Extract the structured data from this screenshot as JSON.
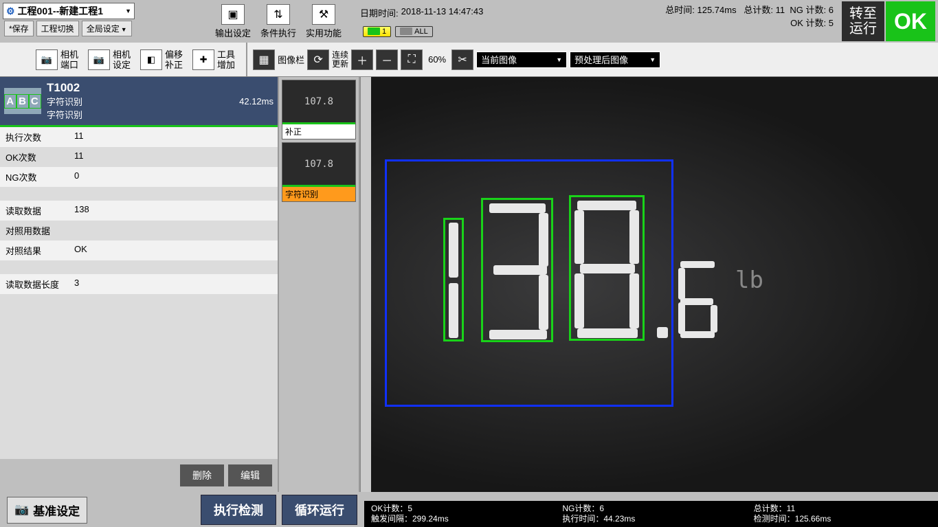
{
  "project": {
    "name": "工程001--新建工程1"
  },
  "topButtons": {
    "save": "*保存",
    "switch": "工程切换",
    "global": "全局设定"
  },
  "tools": {
    "output": "输出设定",
    "condition": "条件执行",
    "utility": "实用功能"
  },
  "datetime": {
    "label": "日期时间:",
    "value": "2018-11-13 14:47:43"
  },
  "summary": {
    "totalTimeLabel": "总时间:",
    "totalTime": "125.74ms",
    "totalCountLabel": "总计数:",
    "totalCount": "11",
    "ngLabel": "NG 计数:",
    "ngCount": "6",
    "okLabel": "OK 计数:",
    "okCount": "5"
  },
  "pills": {
    "one": "1",
    "all": "ALL"
  },
  "runBtn": "转至\n运行",
  "okStatus": "OK",
  "toolbar2": {
    "camPort": {
      "l1": "相机",
      "l2": "端口"
    },
    "camSet": {
      "l1": "相机",
      "l2": "设定"
    },
    "offset": {
      "l1": "偏移",
      "l2": "补正"
    },
    "toolAdd": {
      "l1": "工具",
      "l2": "增加"
    },
    "imgBar": "图像栏",
    "contUpdate": {
      "l1": "连续",
      "l2": "更新"
    },
    "zoom": "60%",
    "ddCurrent": "当前图像",
    "ddPre": "预处理后图像"
  },
  "toolHdr": {
    "id": "T1002",
    "line1": "字符识别",
    "line2": "字符识别",
    "time": "42.12ms"
  },
  "stats": {
    "exec": {
      "k": "执行次数",
      "v": "11"
    },
    "ok": {
      "k": "OK次数",
      "v": "11"
    },
    "ng": {
      "k": "NG次数",
      "v": "0"
    },
    "read": {
      "k": "读取数据",
      "v": "138"
    },
    "ref": {
      "k": "对照用数据",
      "v": ""
    },
    "res": {
      "k": "对照结果",
      "v": "OK"
    },
    "len": {
      "k": "读取数据长度",
      "v": "3"
    }
  },
  "thumbs": {
    "t1": "补正",
    "t2": "字符识别",
    "preview": "107.8"
  },
  "delEdit": {
    "del": "删除",
    "edit": "编辑"
  },
  "bottomLeft": {
    "settings": "基准设定",
    "exec": "执行检测",
    "loop": "循环运行"
  },
  "bottomStats": {
    "okCount": "OK计数：5",
    "trigInterval": "触发间隔：299.24ms",
    "ngCount": "NG计数：6",
    "execTime": "执行时间：44.23ms",
    "total": "总计数：11",
    "detectTime": "检测时间：125.66ms"
  },
  "viewer": {
    "decimal": ".",
    "unit": "lb",
    "six": "6"
  }
}
